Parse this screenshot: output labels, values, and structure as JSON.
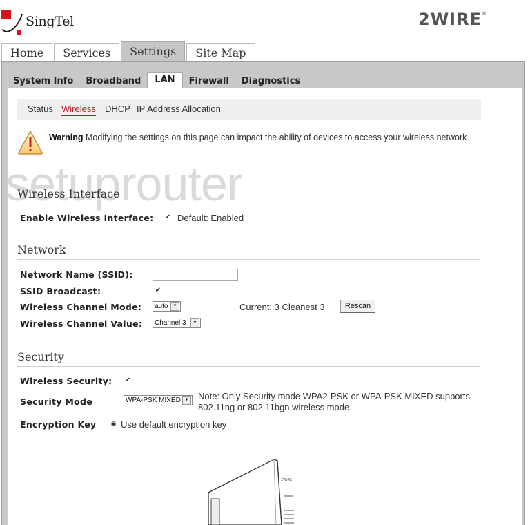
{
  "header": {
    "brand_left": "SingTel",
    "brand_right": "2WIRE",
    "brand_right_mark": "®"
  },
  "main_tabs": [
    {
      "label": "Home",
      "active": false
    },
    {
      "label": "Services",
      "active": false
    },
    {
      "label": "Settings",
      "active": true
    },
    {
      "label": "Site Map",
      "active": false
    }
  ],
  "sub_tabs": [
    {
      "label": "System Info",
      "active": false
    },
    {
      "label": "Broadband",
      "active": false
    },
    {
      "label": "LAN",
      "active": true
    },
    {
      "label": "Firewall",
      "active": false
    },
    {
      "label": "Diagnostics",
      "active": false
    }
  ],
  "section_nav": [
    {
      "label": "Status",
      "active": false
    },
    {
      "label": "Wireless",
      "active": true
    },
    {
      "label": "DHCP",
      "active": false
    },
    {
      "label": "IP Address Allocation",
      "active": false
    }
  ],
  "warning": {
    "icon": "warning-triangle-icon",
    "title": "Warning",
    "message": "Modifying the settings on this page can impact the ability of devices to access your wireless network."
  },
  "watermark": "setuprouter",
  "wireless_interface": {
    "title": "Wireless Interface",
    "enable_label": "Enable Wireless Interface:",
    "enable_checked": true,
    "enable_note": "Default: Enabled"
  },
  "network": {
    "title": "Network",
    "ssid_label": "Network Name (SSID):",
    "ssid_value": "",
    "broadcast_label": "SSID Broadcast:",
    "broadcast_checked": true,
    "channel_mode_label": "Wireless Channel Mode:",
    "channel_mode_value": "auto",
    "channel_value_label": "Wireless Channel Value:",
    "channel_value_value": "Channel 3",
    "current_label": "Current:",
    "current_value": "3",
    "cleanest_label": "Cleanest",
    "cleanest_value": "3",
    "rescan_label": "Rescan"
  },
  "security": {
    "title": "Security",
    "wireless_security_label": "Wireless Security:",
    "wireless_security_checked": true,
    "mode_label": "Security Mode",
    "mode_value": "WPA-PSK MIXED",
    "mode_note_line1": "Note: Only Security mode WPA2-PSK or WPA-PSK MIXED supports",
    "mode_note_line2": "802.11ng or 802.11bgn wireless mode.",
    "encryption_label": "Encryption Key",
    "encryption_option": "Use default encryption key",
    "encryption_selected": true
  },
  "colors": {
    "brand_red": "#d7141c",
    "active_link": "#b21f24",
    "frame_gray": "#c8c8c8"
  }
}
